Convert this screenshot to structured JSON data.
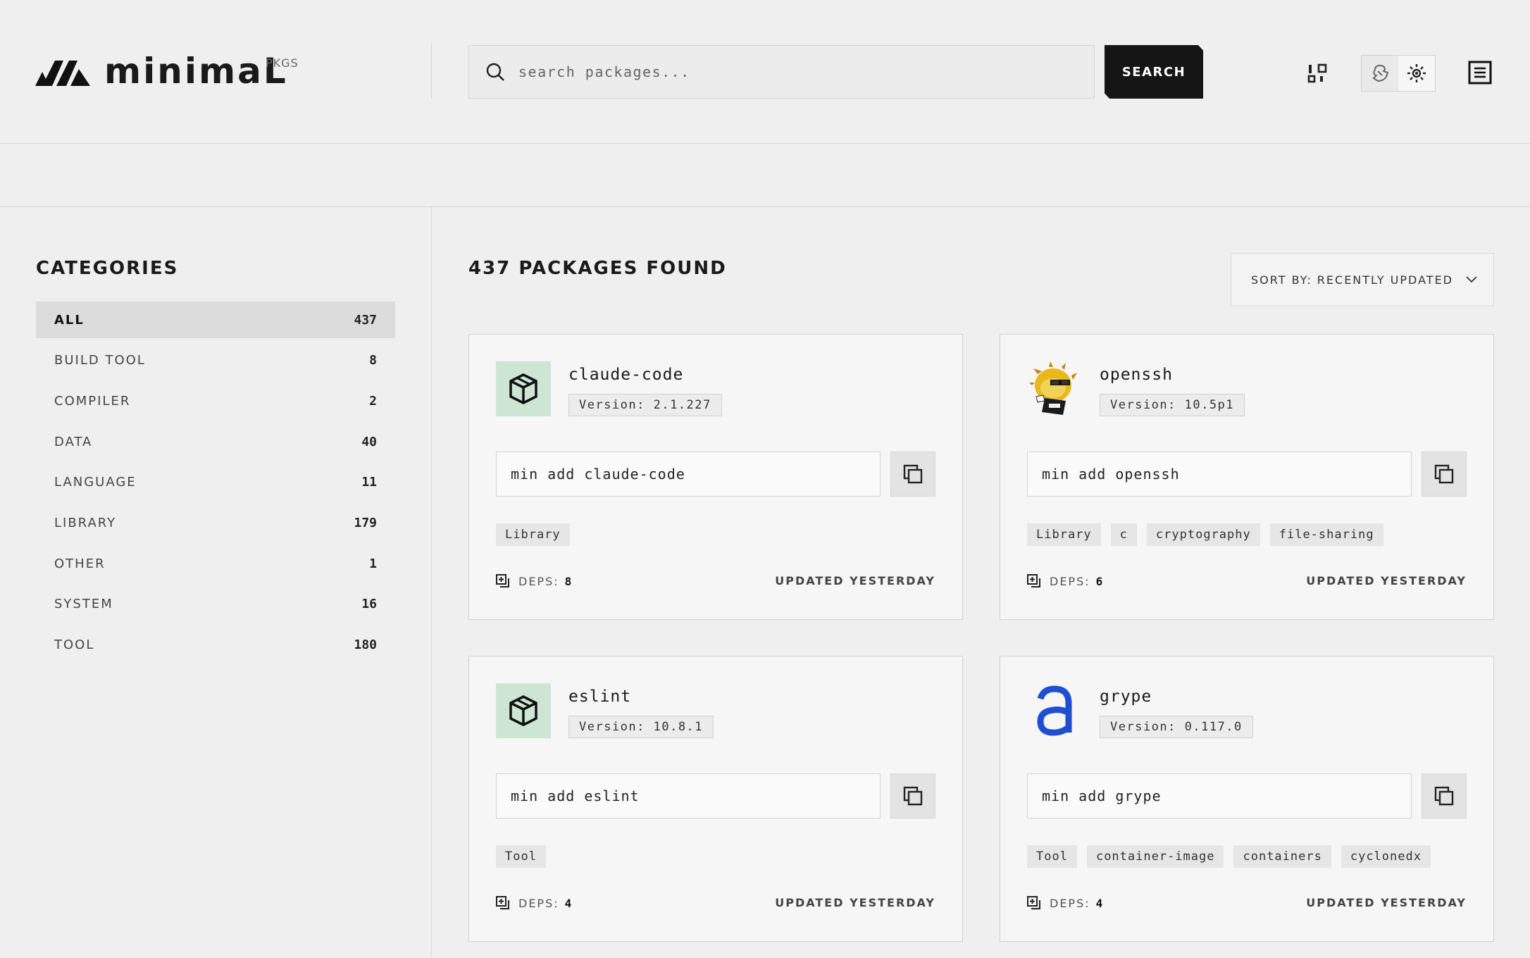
{
  "header": {
    "logo_text": "minimaL",
    "logo_sub": "PKGS",
    "search_placeholder": "search packages...",
    "search_button": "SEARCH"
  },
  "sidebar": {
    "title": "CATEGORIES",
    "categories": [
      {
        "label": "ALL",
        "count": "437",
        "active": true
      },
      {
        "label": "BUILD TOOL",
        "count": "8"
      },
      {
        "label": "COMPILER",
        "count": "2"
      },
      {
        "label": "DATA",
        "count": "40"
      },
      {
        "label": "LANGUAGE",
        "count": "11"
      },
      {
        "label": "LIBRARY",
        "count": "179"
      },
      {
        "label": "OTHER",
        "count": "1"
      },
      {
        "label": "SYSTEM",
        "count": "16"
      },
      {
        "label": "TOOL",
        "count": "180"
      }
    ]
  },
  "main": {
    "results_title": "437 PACKAGES FOUND",
    "sort_label": "SORT BY: RECENTLY UPDATED",
    "cards": [
      {
        "name": "claude-code",
        "version": "Version: 2.1.227",
        "command": "min add claude-code",
        "tags": [
          "Library"
        ],
        "deps_label": "DEPS:",
        "deps": "8",
        "updated": "UPDATED YESTERDAY",
        "icon": "box-icon"
      },
      {
        "name": "openssh",
        "version": "Version: 10.5p1",
        "command": "min add openssh",
        "tags": [
          "Library",
          "c",
          "cryptography",
          "file-sharing"
        ],
        "deps_label": "DEPS:",
        "deps": "6",
        "updated": "UPDATED YESTERDAY",
        "icon": "pufferfish-icon"
      },
      {
        "name": "eslint",
        "version": "Version: 10.8.1",
        "command": "min add eslint",
        "tags": [
          "Tool"
        ],
        "deps_label": "DEPS:",
        "deps": "4",
        "updated": "UPDATED YESTERDAY",
        "icon": "box-icon"
      },
      {
        "name": "grype",
        "version": "Version: 0.117.0",
        "command": "min add grype",
        "tags": [
          "Tool",
          "container-image",
          "containers",
          "cyclonedx"
        ],
        "deps_label": "DEPS:",
        "deps": "4",
        "updated": "UPDATED YESTERDAY",
        "icon": "anchore-a-icon"
      }
    ]
  },
  "colors": {
    "background": "#efefef",
    "accent_dark": "#151515",
    "icon_green_bg": "#cde6d4",
    "grype_blue": "#1f4fd1"
  }
}
